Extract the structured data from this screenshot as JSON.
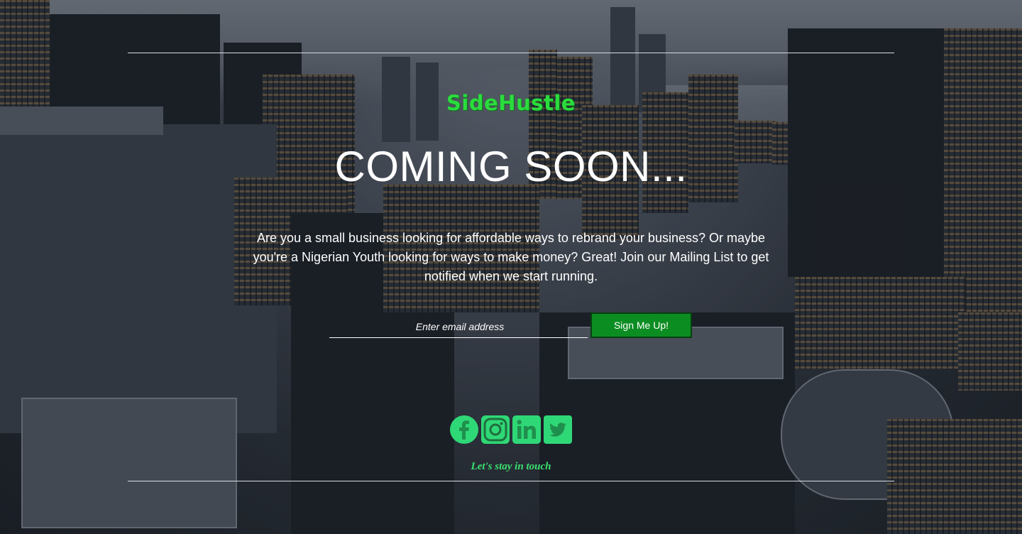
{
  "brand": {
    "logo_text": "SideHustle",
    "logo_color": "#2bdc3e"
  },
  "hero": {
    "headline": "COMING SOON...",
    "description": "Are you a small business looking for affordable ways to rebrand your business? Or maybe you're a Nigerian Youth looking for ways to make money? Great! Join our Mailing List to get notified when we start running."
  },
  "signup_form": {
    "email_placeholder": "Enter email address",
    "submit_label": "Sign Me Up!",
    "submit_color": "#0c8d22"
  },
  "social": {
    "icons": [
      "facebook-icon",
      "instagram-icon",
      "linkedin-icon",
      "twitter-icon"
    ],
    "icon_color": "#2fd876",
    "caption": "Let's stay in touch"
  }
}
